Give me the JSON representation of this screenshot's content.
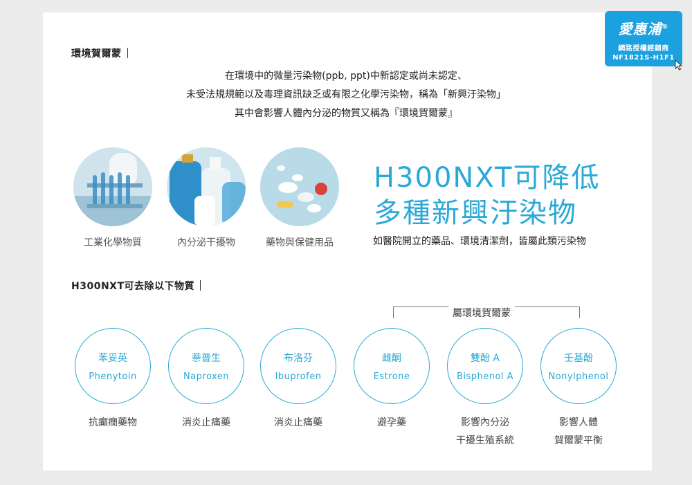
{
  "section1_heading": "環境賀爾蒙",
  "intro_lines": [
    "在環境中的微量污染物(ppb, ppt)中新認定或尚未認定、",
    "未受法規規範以及毒理資訊缺乏或有限之化學污染物，稱為「新興汙染物」",
    "其中會影響人體內分泌的物質又稱為『環境賀爾蒙』"
  ],
  "categories": [
    {
      "label": "工業化學物質",
      "icon": "lab-tubes-image"
    },
    {
      "label": "內分泌干擾物",
      "icon": "plastic-bottles-image"
    },
    {
      "label": "藥物與保健用品",
      "icon": "pills-image"
    }
  ],
  "headline_line1": "H300NXT可降低",
  "headline_line2": "多種新興汙染物",
  "headline_sub": "如醫院開立的藥品、環境清潔劑，皆屬此類污染物",
  "section2_heading": "H300NXT可去除以下物質",
  "bracket_label": "屬環境賀爾蒙",
  "substances": [
    {
      "cn": "苯妥英",
      "en": "Phenytoin",
      "use": [
        "抗癲癇藥物"
      ]
    },
    {
      "cn": "萘普生",
      "en": "Naproxen",
      "use": [
        "消炎止痛藥"
      ]
    },
    {
      "cn": "布洛芬",
      "en": "Ibuprofen",
      "use": [
        "消炎止痛藥"
      ]
    },
    {
      "cn": "雌酮",
      "en": "Estrone",
      "use": [
        "避孕藥"
      ]
    },
    {
      "cn": "雙酚 A",
      "en": "Bisphenol A",
      "use": [
        "影響內分泌",
        "干擾生殖系統"
      ]
    },
    {
      "cn": "壬基酚",
      "en": "Nonylphenol",
      "use": [
        "影響人體",
        "賀爾蒙平衡"
      ]
    }
  ],
  "badge": {
    "logo": "愛惠浦",
    "registered": "®",
    "line2": "網路授權經銷商",
    "line3": "NF1821S-H1F1"
  },
  "colors": {
    "accent": "#2aa8d6",
    "badge": "#1ba0e0",
    "background": "#ececec"
  }
}
